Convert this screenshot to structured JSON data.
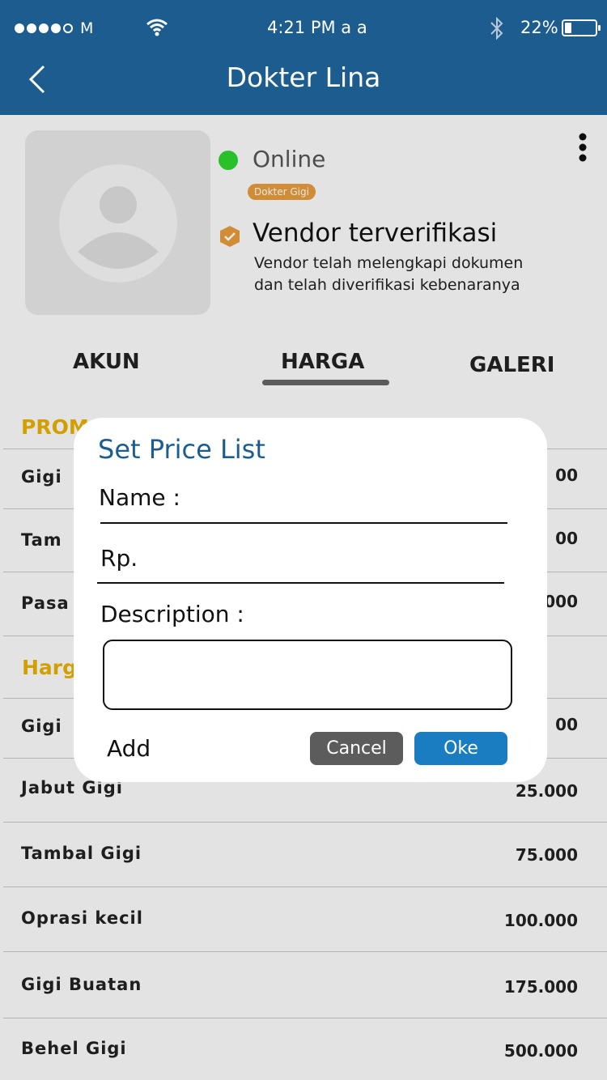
{
  "status_bar": {
    "carrier": "M",
    "time": "4:21 PM  a a",
    "battery": "22%",
    "battery_level": 0.22
  },
  "header": {
    "title": "Dokter Lina"
  },
  "profile": {
    "status": "Online",
    "tag": "Dokter Gigi",
    "verified_title": "Vendor terverifikasi",
    "verified_desc_line1": "Vendor telah melengkapi dokumen",
    "verified_desc_line2": "dan telah diverifikasi kebenaranya"
  },
  "tabs": [
    {
      "label": "AKUN"
    },
    {
      "label": "HARGA"
    },
    {
      "label": "GALERI"
    }
  ],
  "promo": {
    "title": "PROM",
    "items": [
      {
        "name": "Gigi",
        "price": "00"
      },
      {
        "name": "Tam",
        "price": "00"
      },
      {
        "name": "Pasa",
        "price": "000"
      }
    ]
  },
  "harga": {
    "title": "Harg",
    "items": [
      {
        "name": "Gigi",
        "price": "00"
      },
      {
        "name": "Jabut Gigi",
        "price": "25.000"
      },
      {
        "name": "Tambal Gigi",
        "price": "75.000"
      },
      {
        "name": "Oprasi kecil",
        "price": "100.000"
      },
      {
        "name": "Gigi Buatan",
        "price": "175.000"
      },
      {
        "name": "Behel Gigi",
        "price": "500.000"
      }
    ]
  },
  "dialog": {
    "title": "Set Price List",
    "name_label": "Name :",
    "rp_label": "Rp.",
    "desc_label": "Description :",
    "add_label": "Add",
    "cancel_label": "Cancel",
    "ok_label": "Oke"
  },
  "colors": {
    "header": "#1c5c8f",
    "online": "#2ed52e",
    "tag": "#e69a3c",
    "section_title": "#e6b000",
    "ok_button": "#1a7cc1",
    "cancel_button": "#5c5c5c"
  }
}
